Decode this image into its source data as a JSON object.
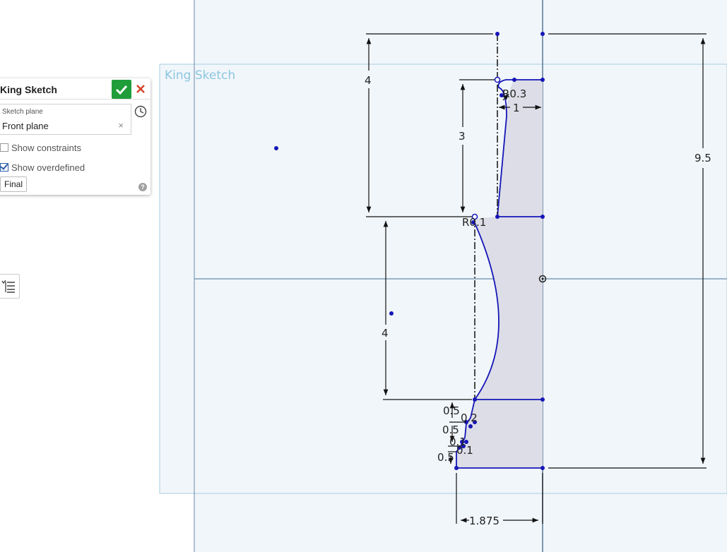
{
  "sketch": {
    "canvas_label": "King Sketch"
  },
  "panel": {
    "title": "King Sketch",
    "plane_label": "Sketch plane",
    "plane_value": "Front plane",
    "plane_clear": "×",
    "show_constraints_label": "Show constraints",
    "show_constraints_checked": false,
    "show_overdefined_label": "Show overdefined",
    "show_overdefined_checked": true,
    "final_label": "Final",
    "help_label": "?"
  },
  "dimensions": {
    "top_height": "4",
    "radius_top": "R0.3",
    "top_width": "1",
    "top_inner_height": "3",
    "overall_height": "9.5",
    "radius_mid": "R0.1",
    "mid_height": "4",
    "step1": "0.5",
    "step2": "0.5",
    "step3": "0.5",
    "small_a": "0.2",
    "small_b": "0.1",
    "small_c": "0.1",
    "base_width": "1.875"
  },
  "colors": {
    "canvas_bg": "#f1f6fa",
    "sketch_frame": "#a7cde0",
    "label": "#8cc6e0",
    "axis": "#7f9bb6",
    "geometry": "#1616b8",
    "fill": "#dcdde6",
    "dimension": "#222222",
    "ok_green": "#1f9d3a",
    "cancel_red": "#d2452a"
  },
  "icons": {
    "ok": "check-icon",
    "cancel": "close-icon",
    "history": "clock-icon",
    "list": "list-icon",
    "help": "help-icon"
  }
}
